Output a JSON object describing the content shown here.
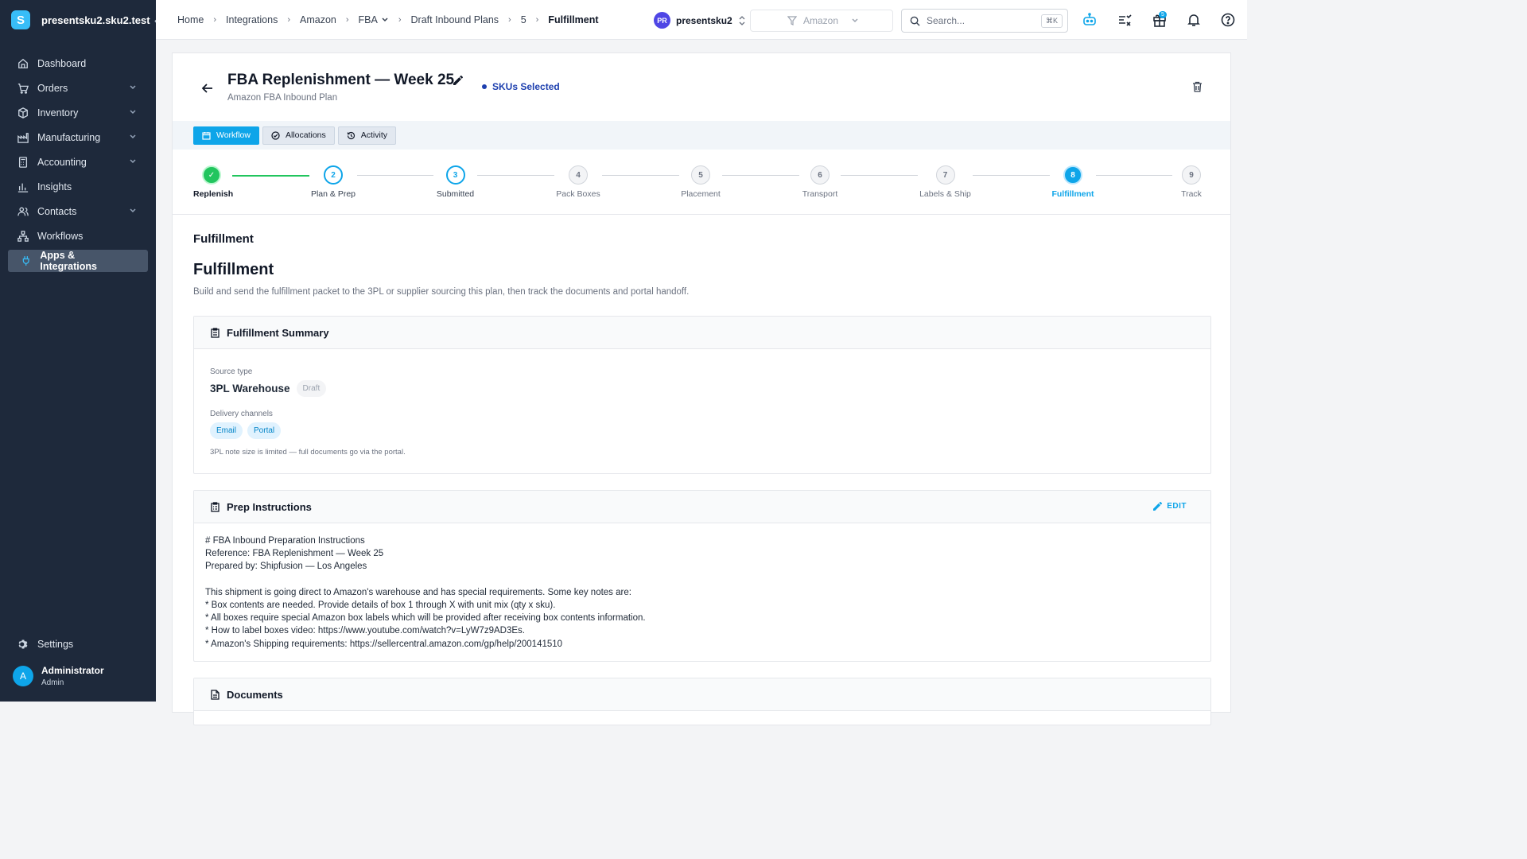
{
  "brand": {
    "logo_letter": "S",
    "name": "presentsku2.sku2.test",
    "collapse": "‹"
  },
  "sidebar": {
    "items": [
      {
        "label": "Dashboard",
        "icon": "home-icon"
      },
      {
        "label": "Orders",
        "icon": "cart-icon",
        "expandable": true
      },
      {
        "label": "Inventory",
        "icon": "box-icon",
        "expandable": true
      },
      {
        "label": "Manufacturing",
        "icon": "factory-icon",
        "expandable": true
      },
      {
        "label": "Accounting",
        "icon": "calculator-icon",
        "expandable": true
      },
      {
        "label": "Insights",
        "icon": "chart-icon"
      },
      {
        "label": "Contacts",
        "icon": "people-icon",
        "expandable": true
      },
      {
        "label": "Workflows",
        "icon": "workflow-icon"
      },
      {
        "label": "Apps & Integrations",
        "icon": "plug-icon",
        "active": true
      }
    ],
    "settings_label": "Settings",
    "user": {
      "initial": "A",
      "name": "Administrator",
      "role": "Admin"
    }
  },
  "topbar": {
    "breadcrumb": [
      "Home",
      "Integrations",
      "Amazon",
      "FBA",
      "Draft Inbound Plans",
      "5",
      "Fulfillment"
    ],
    "account": {
      "initials": "PR",
      "name": "presentsku2"
    },
    "channel_filter": "Amazon",
    "search": {
      "placeholder": "Search...",
      "shortcut": "⌘K"
    },
    "notification_badge": "5"
  },
  "plan": {
    "title": "FBA Replenishment — Week 25",
    "subtitle": "Amazon FBA Inbound Plan",
    "status": "SKUs Selected"
  },
  "tabs": [
    {
      "label": "Workflow",
      "active": true
    },
    {
      "label": "Allocations",
      "active": false
    },
    {
      "label": "Activity",
      "active": false
    }
  ],
  "steps": [
    {
      "number": "✓",
      "label": "Replenish",
      "state": "done"
    },
    {
      "number": "2",
      "label": "Plan & Prep",
      "state": "visited"
    },
    {
      "number": "3",
      "label": "Submitted",
      "state": "visited"
    },
    {
      "number": "4",
      "label": "Pack Boxes",
      "state": "pending"
    },
    {
      "number": "5",
      "label": "Placement",
      "state": "pending"
    },
    {
      "number": "6",
      "label": "Transport",
      "state": "pending"
    },
    {
      "number": "7",
      "label": "Labels & Ship",
      "state": "pending"
    },
    {
      "number": "8",
      "label": "Fulfillment",
      "state": "current"
    },
    {
      "number": "9",
      "label": "Track",
      "state": "pending"
    }
  ],
  "content": {
    "section_label": "Fulfillment",
    "heading": "Fulfillment",
    "description": "Build and send the fulfillment packet to the 3PL or supplier sourcing this plan, then track the documents and portal handoff.",
    "summary": {
      "title": "Fulfillment Summary",
      "source_type_label": "Source type",
      "source_type_value": "3PL Warehouse",
      "source_type_status": "Draft",
      "delivery_label": "Delivery channels",
      "channels": [
        "Email",
        "Portal"
      ],
      "note": "3PL note size is limited — full documents go via the portal."
    },
    "prep": {
      "title": "Prep Instructions",
      "edit_label": "EDIT",
      "text": "# FBA Inbound Preparation Instructions\nReference: FBA Replenishment — Week 25\nPrepared by: Shipfusion — Los Angeles\n\nThis shipment is going direct to Amazon's warehouse and has special requirements. Some key notes are:\n* Box contents are needed. Provide details of box 1 through X with unit mix (qty x sku).\n* All boxes require special Amazon box labels which will be provided after receiving box contents information.\n* How to label boxes video: https://www.youtube.com/watch?v=LyW7z9AD3Es.\n* Amazon's Shipping requirements: https://sellercentral.amazon.com/gp/help/200141510"
    },
    "documents": {
      "title": "Documents"
    }
  }
}
